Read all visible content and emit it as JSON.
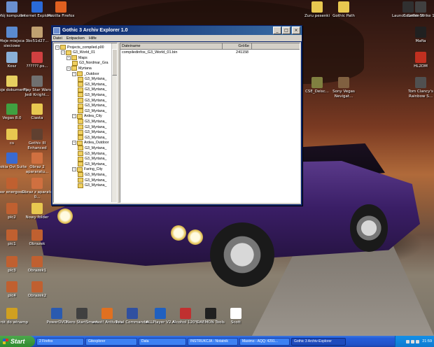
{
  "desktop": {
    "icons_left": [
      {
        "label": "Mój komputer",
        "icon": "computer-icon",
        "color": "#6a8fcf"
      },
      {
        "label": "Internet Explorer",
        "icon": "ie-icon",
        "color": "#2a6ad8"
      },
      {
        "label": "Mozilla Firefox",
        "icon": "firefox-icon",
        "color": "#e06020"
      },
      {
        "label": "Moje miejsca sieciowe",
        "icon": "network-icon",
        "color": "#5a8ad0"
      },
      {
        "label": "3bc51d27...",
        "icon": "image-file-icon",
        "color": "#c0a070"
      },
      {
        "label": "Kosz",
        "icon": "recycle-bin-icon",
        "color": "#8ab0d8"
      },
      {
        "label": "??????.ps...",
        "icon": "doc-icon",
        "color": "#d04040"
      },
      {
        "label": "Moje dokumenty",
        "icon": "documents-icon",
        "color": "#e8d060"
      },
      {
        "label": "Play Star Wars Jedi Knight...",
        "icon": "game-icon",
        "color": "#707070"
      },
      {
        "label": "Vegas 8.0",
        "icon": "vegas-icon",
        "color": "#40a040"
      },
      {
        "label": "Ciasta",
        "icon": "folder-icon",
        "color": "#e8c850"
      },
      {
        "label": "cs",
        "icon": "folder-icon",
        "color": "#e8c850"
      },
      {
        "label": "Gothic III Enhanced",
        "icon": "game-icon",
        "color": "#604030"
      },
      {
        "label": "Nokia Ovi Suite",
        "icon": "nokia-icon",
        "color": "#3a6ad0"
      },
      {
        "label": "Obraz 2 apararatu...",
        "icon": "image-file-icon",
        "color": "#d07040"
      },
      {
        "label": "nasr energoss...",
        "icon": "image-file-icon",
        "color": "#c06030"
      },
      {
        "label": "Obraz z aparatu 0...",
        "icon": "image-file-icon",
        "color": "#d07040"
      },
      {
        "label": "pic2",
        "icon": "image-file-icon",
        "color": "#c06030"
      },
      {
        "label": "Nowy folder",
        "icon": "folder-icon",
        "color": "#e8c850"
      },
      {
        "label": "pic1",
        "icon": "image-file-icon",
        "color": "#c06030"
      },
      {
        "label": "Obrazek",
        "icon": "image-file-icon",
        "color": "#c06030"
      },
      {
        "label": "pic3",
        "icon": "image-file-icon",
        "color": "#c06030"
      },
      {
        "label": "Obrazek1",
        "icon": "image-file-icon",
        "color": "#c06030"
      },
      {
        "label": "pic4",
        "icon": "image-file-icon",
        "color": "#c06030"
      },
      {
        "label": "Obrazek2",
        "icon": "image-file-icon",
        "color": "#c06030"
      }
    ],
    "icons_bottom": [
      {
        "label": "Skrót do winamp",
        "icon": "winamp-icon",
        "color": "#d0a020"
      },
      {
        "label": "PowerDVD",
        "icon": "dvd-icon",
        "color": "#2a5ab0"
      },
      {
        "label": "Nero StartSmart",
        "icon": "nero-icon",
        "color": "#404040"
      },
      {
        "label": "avast! Antivirus",
        "icon": "avast-icon",
        "color": "#e07020"
      },
      {
        "label": "Total Commander",
        "icon": "tc-icon",
        "color": "#3050a0"
      },
      {
        "label": "ALLPlayer V2.4",
        "icon": "allplayer-icon",
        "color": "#2060c0"
      },
      {
        "label": "Alcohol 120%",
        "icon": "alcohol-icon",
        "color": "#c03030"
      },
      {
        "label": "DAEMON Tools",
        "icon": "daemon-icon",
        "color": "#202020"
      },
      {
        "label": "Scott",
        "icon": "scott-icon",
        "color": "#ffffff"
      }
    ],
    "icons_right": [
      {
        "label": "Zuru pesenki",
        "icon": "folder-icon",
        "color": "#e8c850"
      },
      {
        "label": "Gothic Path",
        "icon": "folder-icon",
        "color": "#e8c850"
      },
      {
        "label": "Launch Gothic III",
        "icon": "gothic-icon",
        "color": "#303030"
      },
      {
        "label": "Counter-Strike 1.6",
        "icon": "cs-icon",
        "color": "#404040"
      },
      {
        "label": "Mafia",
        "icon": "mafia-icon",
        "color": "#202020"
      },
      {
        "label": "HL2DM",
        "icon": "hl2-icon",
        "color": "#c03020"
      },
      {
        "label": "CSE_Deisc...",
        "icon": "game-icon",
        "color": "#808040"
      },
      {
        "label": "Sony Vegas Nevigat...",
        "icon": "game-icon",
        "color": "#806040"
      },
      {
        "label": "Tom Clancy's Rainbow S...",
        "icon": "game-icon",
        "color": "#505050"
      }
    ]
  },
  "window": {
    "title": "Gothic 3 Archiv Explorer 1.0",
    "controls": {
      "minimize": "_",
      "maximize": "□",
      "close": "×"
    },
    "menu": [
      "Datei",
      "Entpacken",
      "Hilfe"
    ],
    "tree": [
      {
        "label": "Projects_compiled.p00",
        "level": 0,
        "exp": "−"
      },
      {
        "label": "G3_World_01",
        "level": 1,
        "exp": "−"
      },
      {
        "label": "Maps",
        "level": 2,
        "exp": "−"
      },
      {
        "label": "G3_Nordmar_Gra",
        "level": 3,
        "exp": ""
      },
      {
        "label": "Myrtana",
        "level": 2,
        "exp": "−"
      },
      {
        "label": "_Outdoor",
        "level": 3,
        "exp": "−"
      },
      {
        "label": "G3_Myrtana_",
        "level": 4,
        "exp": ""
      },
      {
        "label": "G3_Myrtana_",
        "level": 4,
        "exp": ""
      },
      {
        "label": "G3_Myrtana_",
        "level": 4,
        "exp": ""
      },
      {
        "label": "G3_Myrtana_",
        "level": 4,
        "exp": ""
      },
      {
        "label": "G3_Myrtana_",
        "level": 4,
        "exp": ""
      },
      {
        "label": "G3_Myrtana_",
        "level": 4,
        "exp": ""
      },
      {
        "label": "G3_Myrtana_",
        "level": 4,
        "exp": ""
      },
      {
        "label": "Ardea_City",
        "level": 3,
        "exp": "−"
      },
      {
        "label": "G3_Myrtana_",
        "level": 4,
        "exp": ""
      },
      {
        "label": "G3_Myrtana_",
        "level": 4,
        "exp": ""
      },
      {
        "label": "G3_Myrtana_",
        "level": 4,
        "exp": ""
      },
      {
        "label": "G3_Myrtana_",
        "level": 4,
        "exp": ""
      },
      {
        "label": "Ardea_Outdoor",
        "level": 3,
        "exp": "−"
      },
      {
        "label": "G3_Myrtana_",
        "level": 4,
        "exp": ""
      },
      {
        "label": "G3_Myrtana_",
        "level": 4,
        "exp": ""
      },
      {
        "label": "G3_Myrtana_",
        "level": 4,
        "exp": ""
      },
      {
        "label": "G3_Myrtana_",
        "level": 4,
        "exp": ""
      },
      {
        "label": "Faring_City",
        "level": 3,
        "exp": "−"
      },
      {
        "label": "G3_Myrtana_",
        "level": 4,
        "exp": ""
      },
      {
        "label": "G3_Myrtana_",
        "level": 4,
        "exp": ""
      },
      {
        "label": "G3_Myrtana_",
        "level": 4,
        "exp": ""
      }
    ],
    "list": {
      "headers": [
        "Dateiname",
        "Größe"
      ],
      "rows": [
        {
          "name": "compiledinfos_G3_World_01.bin",
          "size": "241158"
        }
      ]
    }
  },
  "taskbar": {
    "start_label": "Start",
    "items": [
      {
        "label": "2 Firefox",
        "active": false
      },
      {
        "label": "Gitexplorer",
        "active": false
      },
      {
        "label": "Data",
        "active": false
      },
      {
        "label": "INSTRUKCJA - Notatnik",
        "active": false
      },
      {
        "label": "Maximo - AQQ: 4291...",
        "active": false
      },
      {
        "label": "Gothic 3 Archiv-Explorer",
        "active": true
      }
    ],
    "clock": "21:59"
  }
}
